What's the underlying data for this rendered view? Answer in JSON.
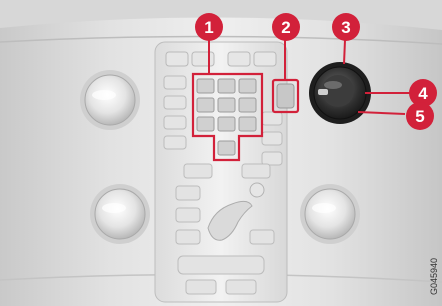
{
  "photo": {
    "subject": "Volvo center console control panel",
    "image_code": "G045940"
  },
  "callouts": [
    {
      "number": "1"
    },
    {
      "number": "2"
    },
    {
      "number": "3"
    },
    {
      "number": "4"
    },
    {
      "number": "5"
    }
  ],
  "colors": {
    "callout": "#d2213a",
    "highlight": "#d2213a",
    "callout_text": "#ffffff"
  }
}
